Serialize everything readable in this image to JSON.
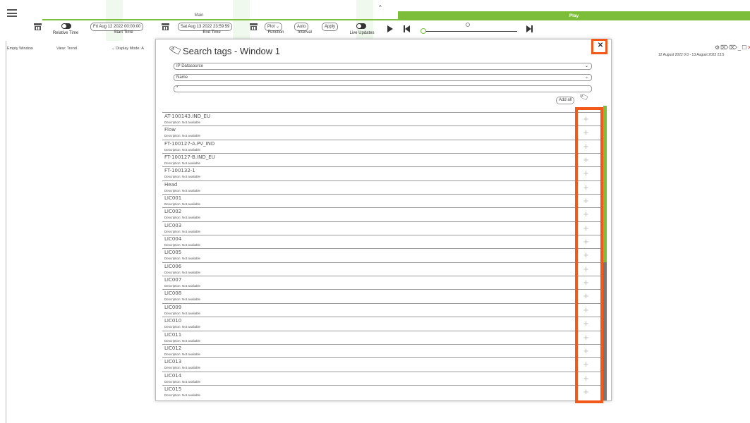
{
  "topbar": {
    "main_label": "Main",
    "play_label": "Play",
    "relative_time_label": "Relative Time",
    "start_time_value": "Fri Aug 12 2022  00:00:00",
    "start_time_label": "Start Time",
    "end_time_value": "Sat Aug 13 2022  23:59:59",
    "end_time_label": "End Time",
    "function_value": "Plot",
    "function_label": "Function",
    "interval_value": "Auto",
    "interval_label": "Interval",
    "apply_label": "Apply",
    "live_updates_label": "Live Updates"
  },
  "window_header": {
    "name": "Empty Window",
    "view": "View: Trend",
    "display_mode": "Display Mode: A",
    "range": "12 August 2022 0:0 - 13 August 2022 23:5"
  },
  "dialog": {
    "title": "Search tags - Window 1",
    "datasource": "IP Datasource",
    "field": "Name",
    "search_value": "*",
    "add_all_label": "Add all"
  },
  "tags": [
    {
      "name": "AT-100143.IND_EU",
      "description": "Description: Not available"
    },
    {
      "name": "Flow",
      "description": "Description: Not available"
    },
    {
      "name": "FT-100127-A.PV_IND",
      "description": "Description: Not available"
    },
    {
      "name": "FT-100127-B.IND_EU",
      "description": "Description: Not available"
    },
    {
      "name": "FT-100132-1",
      "description": "Description: Not available"
    },
    {
      "name": "Head",
      "description": "Description: Not available"
    },
    {
      "name": "LIC001",
      "description": "Description: Not available"
    },
    {
      "name": "LIC002",
      "description": "Description: Not available"
    },
    {
      "name": "LIC003",
      "description": "Description: Not available"
    },
    {
      "name": "LIC004",
      "description": "Description: Not available"
    },
    {
      "name": "LIC005",
      "description": "Description: Not available"
    },
    {
      "name": "LIC006",
      "description": "Description: Not available"
    },
    {
      "name": "LIC007",
      "description": "Description: Not available"
    },
    {
      "name": "LIC008",
      "description": "Description: Not available"
    },
    {
      "name": "LIC009",
      "description": "Description: Not available"
    },
    {
      "name": "LIC010",
      "description": "Description: Not available"
    },
    {
      "name": "LIC011",
      "description": "Description: Not available"
    },
    {
      "name": "LIC012",
      "description": "Description: Not available"
    },
    {
      "name": "LIC013",
      "description": "Description: Not available"
    },
    {
      "name": "LIC014",
      "description": "Description: Not available"
    },
    {
      "name": "LIC015",
      "description": "Description: Not available"
    }
  ],
  "colors": {
    "accent_green": "#7cbe3a",
    "highlight_orange": "#f25a1c",
    "close_red": "#d9302a"
  },
  "icons": {
    "tag": "tag-icon",
    "add": "plus-icon",
    "close": "close-icon"
  }
}
